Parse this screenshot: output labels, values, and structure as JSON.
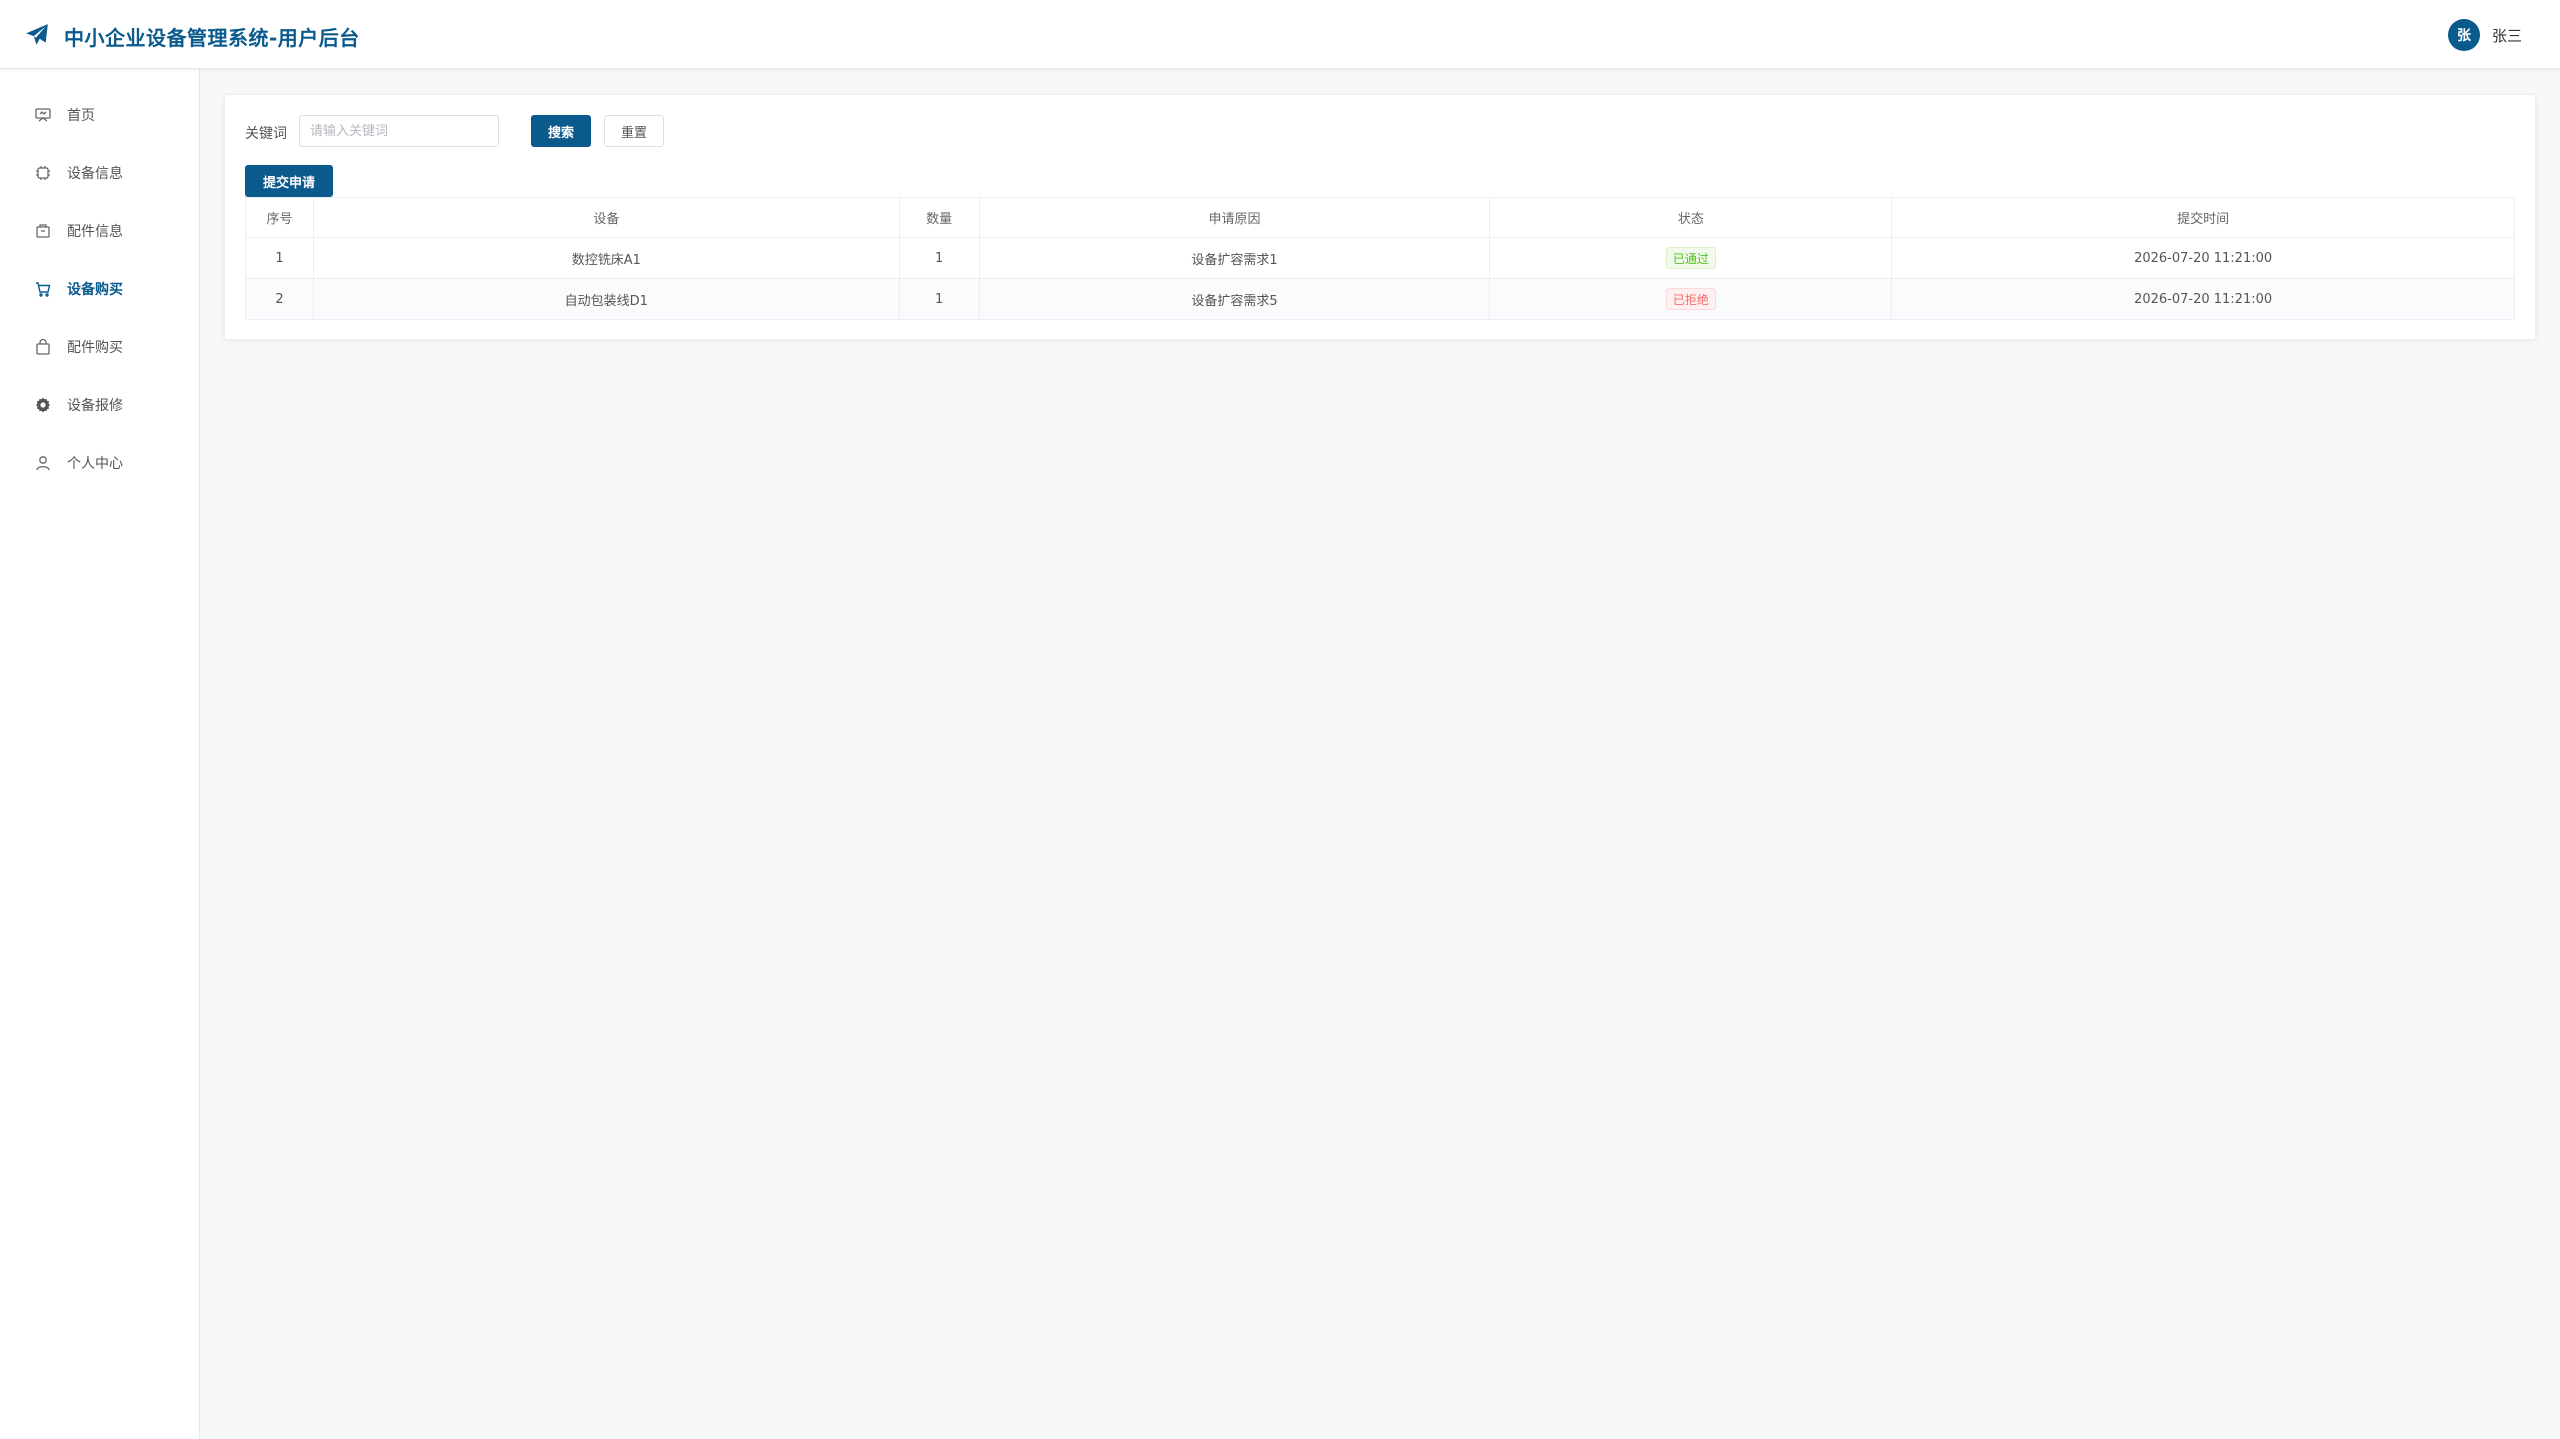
{
  "header": {
    "title": "中小企业设备管理系统-用户后台",
    "avatar_text": "张",
    "username": "张三",
    "accent_color": "#0b5a8e"
  },
  "sidebar": {
    "items": [
      {
        "label": "首页",
        "icon": "home-board-icon",
        "active": false
      },
      {
        "label": "设备信息",
        "icon": "chip-icon",
        "active": false
      },
      {
        "label": "配件信息",
        "icon": "box-icon",
        "active": false
      },
      {
        "label": "设备购买",
        "icon": "cart-icon",
        "active": true
      },
      {
        "label": "配件购买",
        "icon": "bag-icon",
        "active": false
      },
      {
        "label": "设备报修",
        "icon": "gear-icon",
        "active": false
      },
      {
        "label": "个人中心",
        "icon": "user-icon",
        "active": false
      }
    ]
  },
  "search": {
    "keyword_label": "关键词",
    "placeholder": "请输入关键词",
    "value": "",
    "search_label": "搜索",
    "reset_label": "重置"
  },
  "toolbar": {
    "submit_label": "提交申请"
  },
  "table": {
    "headers": [
      "序号",
      "设备",
      "数量",
      "申请原因",
      "状态",
      "提交时间"
    ],
    "rows": [
      {
        "index": "1",
        "device": "数控铣床A1",
        "qty": "1",
        "reason": "设备扩容需求1",
        "status": "已通过",
        "status_color": "#52c41a",
        "time": "2026-07-20 11:21:00"
      },
      {
        "index": "2",
        "device": "自动包装线D1",
        "qty": "1",
        "reason": "设备扩容需求5",
        "status": "已拒绝",
        "status_color": "#f56c6c",
        "time": "2026-07-20 11:21:00"
      }
    ]
  }
}
